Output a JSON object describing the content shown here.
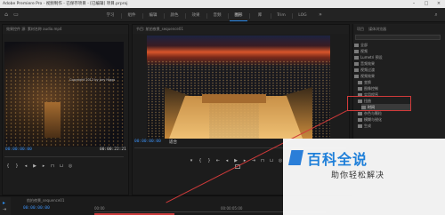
{
  "titlebar": {
    "text": "Adobe Premiere Pro - 视频制作 - 已保存项目 - [已编辑] 项目.prproj"
  },
  "menubar": {
    "tabs": [
      {
        "label": "学习"
      },
      {
        "label": "组件"
      },
      {
        "label": "编辑"
      },
      {
        "label": "颜色"
      },
      {
        "label": "效果"
      },
      {
        "label": "音频"
      },
      {
        "label": "图形"
      },
      {
        "label": "库"
      },
      {
        "label": "Trim"
      },
      {
        "label": "LOG"
      }
    ],
    "active_tab_index": 6
  },
  "source_monitor": {
    "header": "效果控件   源: 素材名称 audio.mp4",
    "watermark_text": "Copyright 2012 by Jory Higgs",
    "timecode_left": "00:00:00:00",
    "timecode_right": "00:00:22:21"
  },
  "program_monitor": {
    "header": "节目: 航拍夜景_sequence01",
    "timecode_left": "00:00:00:00",
    "fit_label": "适合"
  },
  "project_panel": {
    "header_tabs": [
      "项目",
      "媒体浏览器"
    ],
    "items": [
      {
        "label": "全部"
      },
      {
        "label": "视频"
      },
      {
        "label": "Lumetri 预设"
      },
      {
        "label": "音频效果"
      },
      {
        "label": "视频过渡"
      },
      {
        "label": "视频效果"
      },
      {
        "label": "变换"
      },
      {
        "label": "图像控制"
      },
      {
        "label": "实用程序"
      },
      {
        "label": "扭曲"
      },
      {
        "label": "时间"
      },
      {
        "label": "杂色与颗粒"
      },
      {
        "label": "模糊与锐化"
      },
      {
        "label": "生成"
      }
    ],
    "selected_item": "时间"
  },
  "timeline": {
    "header": "航拍夜景_sequence01",
    "timecode": "00:00:00:00",
    "ruler_start": "00:00",
    "ruler_end": "00:00:05:00"
  },
  "watermark": {
    "title": "百科全说",
    "subtitle": "助你轻松解决"
  },
  "colors": {
    "accent": "#2d8ceb",
    "highlight_box": "#d03a3a",
    "watermark_blue": "#1e7fd9"
  }
}
